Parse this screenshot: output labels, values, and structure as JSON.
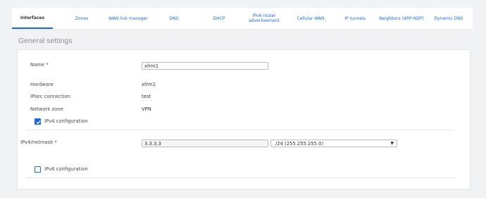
{
  "tabs": [
    {
      "label": "Interfaces",
      "active": true
    },
    {
      "label": "Zones"
    },
    {
      "label": "WAN link manager"
    },
    {
      "label": "DNS"
    },
    {
      "label": "DHCP"
    },
    {
      "label": "IPv6 router advertisement"
    },
    {
      "label": "Cellular WAN"
    },
    {
      "label": "IP tunnels"
    },
    {
      "label": "Neighbors (ARP-NDP)"
    },
    {
      "label": "Dynamic DNS"
    }
  ],
  "section_title": "General settings",
  "form": {
    "name_label": "Name *",
    "name_value": "xfrm1",
    "hardware_label": "Hardware",
    "hardware_value": "xfrm1",
    "ipsec_label": "IPsec connection",
    "ipsec_value": "test",
    "zone_label": "Network zone",
    "zone_value": "VPN",
    "ipv4_config_label": "IPv4 configuration",
    "ipv4_netmask_label": "IPv4/netmask *",
    "ipv4_value": "3.3.3.3",
    "netmask_value": "/24 (255.255.255.0)",
    "ipv6_config_label": "IPv6 configuration"
  },
  "colors": {
    "accent": "#1a6ad7"
  }
}
